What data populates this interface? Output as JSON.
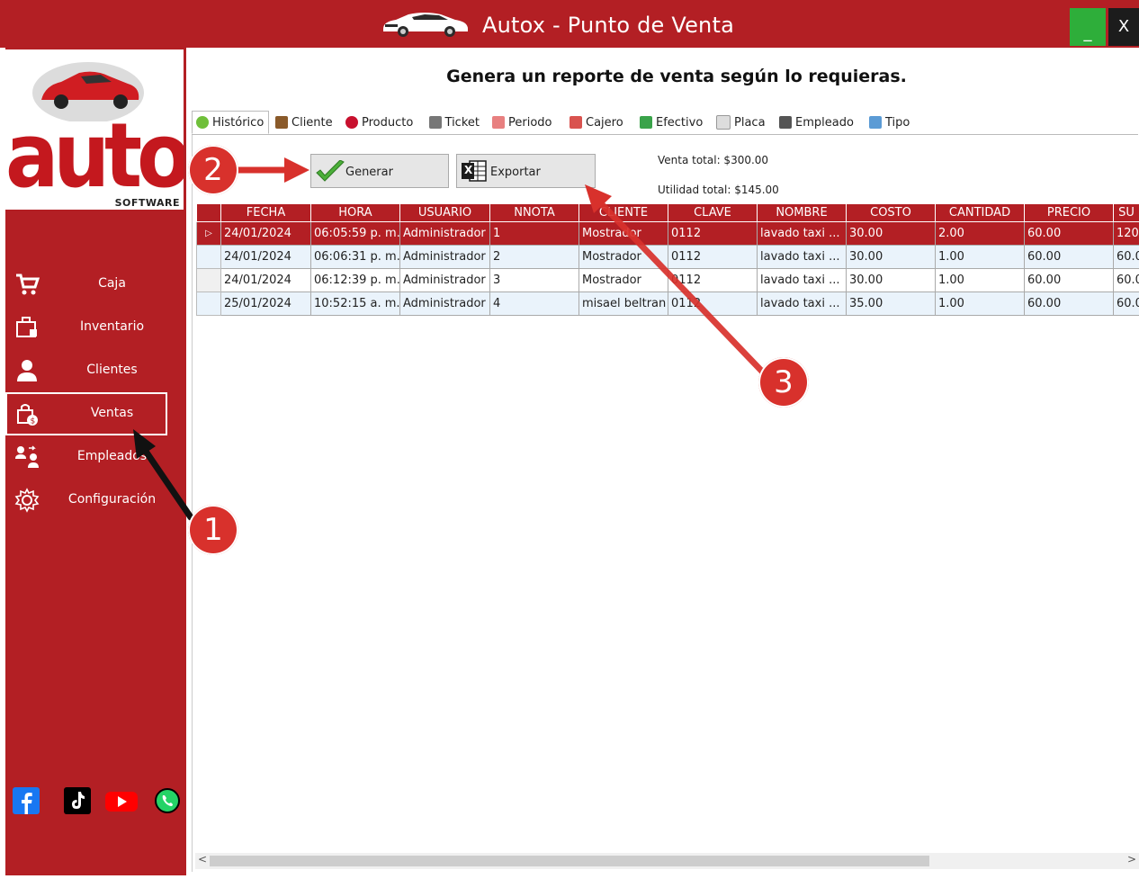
{
  "window": {
    "title": "Autox - Punto de Venta",
    "minimize_label": "_",
    "close_label": "X"
  },
  "logo": {
    "brand": "autox",
    "sub": "SOFTWARE"
  },
  "sidebar": {
    "items": [
      {
        "label": "Caja",
        "icon": "cart-icon"
      },
      {
        "label": "Inventario",
        "icon": "inventory-icon"
      },
      {
        "label": "Clientes",
        "icon": "user-icon"
      },
      {
        "label": "Ventas",
        "icon": "sales-bag-icon"
      },
      {
        "label": "Empleados",
        "icon": "employees-icon"
      },
      {
        "label": "Configuración",
        "icon": "gear-icon"
      }
    ],
    "active": "Ventas",
    "social": [
      "facebook-icon",
      "tiktok-icon",
      "youtube-icon",
      "whatsapp-icon"
    ]
  },
  "main": {
    "heading": "Genera un reporte de venta según lo requieras.",
    "tabs": [
      {
        "label": "Histórico",
        "active": true
      },
      {
        "label": "Cliente"
      },
      {
        "label": "Producto"
      },
      {
        "label": "Ticket"
      },
      {
        "label": "Periodo"
      },
      {
        "label": "Cajero"
      },
      {
        "label": "Efectivo"
      },
      {
        "label": "Placa"
      },
      {
        "label": "Empleado"
      },
      {
        "label": "Tipo"
      }
    ],
    "generate_label": "Generar",
    "export_label": "Exportar",
    "export_icon_text": "X",
    "venta_total": "Venta total: $300.00",
    "utilidad_total": "Utilidad total: $145.00"
  },
  "table": {
    "columns": [
      "FECHA",
      "HORA",
      "USUARIO",
      "NNOTA",
      "CLIENTE",
      "CLAVE",
      "NOMBRE",
      "COSTO",
      "CANTIDAD",
      "PRECIO",
      "SU"
    ],
    "selected_marker": "▷",
    "rows": [
      [
        "24/01/2024",
        "06:05:59 p. m.",
        "Administrador",
        "1",
        "Mostrador",
        "0112",
        "lavado taxi ...",
        "30.00",
        "2.00",
        "60.00",
        "120."
      ],
      [
        "24/01/2024",
        "06:06:31 p. m.",
        "Administrador",
        "2",
        "Mostrador",
        "0112",
        "lavado taxi ...",
        "30.00",
        "1.00",
        "60.00",
        "60.0"
      ],
      [
        "24/01/2024",
        "06:12:39 p. m.",
        "Administrador",
        "3",
        "Mostrador",
        "0112",
        "lavado taxi ...",
        "30.00",
        "1.00",
        "60.00",
        "60.0"
      ],
      [
        "25/01/2024",
        "10:52:15 a. m.",
        "Administrador",
        "4",
        "misael beltran",
        "0112",
        "lavado taxi ...",
        "35.00",
        "1.00",
        "60.00",
        "60.0"
      ]
    ]
  },
  "annotations": {
    "badge1": "1",
    "badge2": "2",
    "badge3": "3",
    "colors": {
      "red": "#d8312c",
      "black": "#111111"
    }
  },
  "colors": {
    "brand_red": "#b31f24",
    "minimize_green": "#2eae3a",
    "row_alt": "#eaf3fb"
  }
}
